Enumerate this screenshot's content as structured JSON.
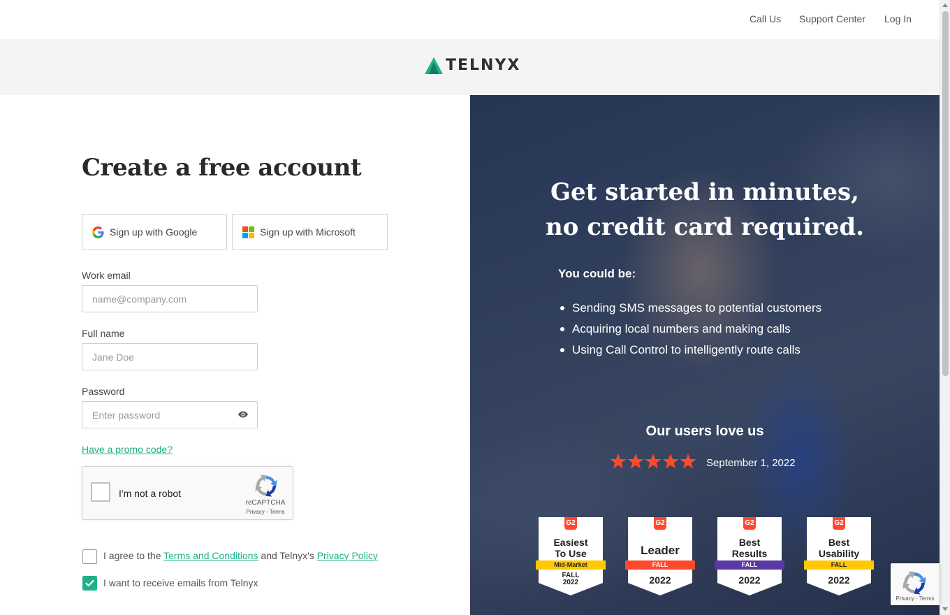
{
  "nav": {
    "call_us": "Call Us",
    "support_center": "Support Center",
    "log_in": "Log In"
  },
  "brand": {
    "name": "TELNYX",
    "accent_color": "#1fb089"
  },
  "form": {
    "title": "Create a free account",
    "google_button": "Sign up with Google",
    "microsoft_button": "Sign up with Microsoft",
    "email_label": "Work email",
    "email_placeholder": "name@company.com",
    "email_value": "",
    "name_label": "Full name",
    "name_placeholder": "Jane Doe",
    "name_value": "",
    "password_label": "Password",
    "password_placeholder": "Enter password",
    "password_value": "",
    "promo_link": "Have a promo code?",
    "captcha": {
      "label": "I'm not a robot",
      "brand": "reCAPTCHA",
      "links": "Privacy - Terms",
      "checked": false
    },
    "agree": {
      "prefix": "I agree to the ",
      "terms_link": "Terms and Conditions",
      "middle": " and Telnyx's ",
      "privacy_link": "Privacy Policy",
      "checked": false
    },
    "emails": {
      "label": "I want to receive emails from Telnyx",
      "checked": true
    }
  },
  "hero": {
    "title": "Get started in minutes, no credit card required.",
    "subtitle": "You could be:",
    "bullets": [
      "Sending SMS messages to potential customers",
      "Acquiring local numbers and making calls",
      "Using Call Control to intelligently route calls"
    ],
    "love_heading": "Our users love us",
    "rating_stars": 5,
    "rating_date": "September 1, 2022",
    "star_color": "#ff492c",
    "badges": [
      {
        "logo": "G2",
        "line1": "Easiest",
        "line2": "To Use",
        "ribbon": "Mid-Market",
        "ribbon_color": "#ffc800",
        "season": "FALL",
        "year": "2022"
      },
      {
        "logo": "G2",
        "line1": "Leader",
        "line2": "",
        "ribbon": "FALL",
        "ribbon_color": "#ff492c",
        "season": "",
        "year": "2022"
      },
      {
        "logo": "G2",
        "line1": "Best",
        "line2": "Results",
        "ribbon": "FALL",
        "ribbon_color": "#5a39a2",
        "season": "",
        "year": "2022"
      },
      {
        "logo": "G2",
        "line1": "Best",
        "line2": "Usability",
        "ribbon": "FALL",
        "ribbon_color": "#ffc800",
        "season": "",
        "year": "2022"
      }
    ]
  },
  "recaptcha_float": {
    "links": "Privacy - Terms"
  }
}
